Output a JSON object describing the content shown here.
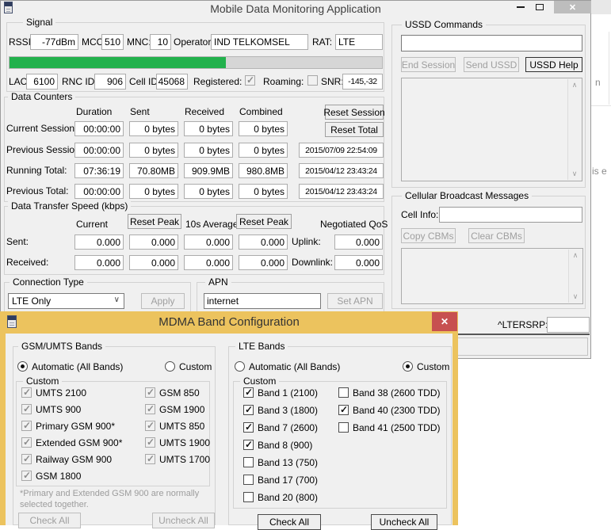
{
  "window": {
    "title": "Mobile Data Monitoring Application"
  },
  "icons": {
    "close_x": "✕",
    "scroll_up": "∧",
    "scroll_down": "∨",
    "combo_chevron": "∨"
  },
  "signal": {
    "legend": "Signal",
    "rssi_label": "RSSI:",
    "rssi": "-77dBm",
    "mcc_label": "MCC:",
    "mcc": "510",
    "mnc_label": "MNC:",
    "mnc": "10",
    "operator_label": "Operator:",
    "operator": "IND TELKOMSEL",
    "rat_label": "RAT:",
    "rat": "LTE",
    "strength_percent": 58,
    "lac_label": "LAC:",
    "lac": "6100",
    "rnc_label": "RNC ID:",
    "rnc": "906",
    "cellid_label": "Cell ID:",
    "cellid": "45068",
    "registered_label": "Registered:",
    "registered_checked": true,
    "roaming_label": "Roaming:",
    "roaming_checked": false,
    "snr_label": "SNR:",
    "snr": "-145,-32"
  },
  "counters": {
    "legend": "Data Counters",
    "headers": {
      "duration": "Duration",
      "sent": "Sent",
      "received": "Received",
      "combined": "Combined"
    },
    "reset_session_btn": "Reset Session",
    "reset_total_btn": "Reset Total",
    "rows": [
      {
        "label": "Current Session:",
        "duration": "00:00:00",
        "sent": "0 bytes",
        "received": "0 bytes",
        "combined": "0 bytes",
        "timestamp": ""
      },
      {
        "label": "Previous Session:",
        "duration": "00:00:00",
        "sent": "0 bytes",
        "received": "0 bytes",
        "combined": "0 bytes",
        "timestamp": "2015/07/09 22:54:09"
      },
      {
        "label": "Running Total:",
        "duration": "07:36:19",
        "sent": "70.80MB",
        "received": "909.9MB",
        "combined": "980.8MB",
        "timestamp": "2015/04/12 23:43:24"
      },
      {
        "label": "Previous Total:",
        "duration": "00:00:00",
        "sent": "0 bytes",
        "received": "0 bytes",
        "combined": "0 bytes",
        "timestamp": "2015/04/12 23:43:24"
      }
    ]
  },
  "speed": {
    "legend": "Data Transfer Speed (kbps)",
    "current_header": "Current",
    "reset_peak_btn": "Reset Peak",
    "avg_header": "10s Average",
    "qos_header": "Negotiated QoS",
    "rows": [
      {
        "label": "Sent:",
        "values": [
          "0.000",
          "0.000",
          "0.000",
          "0.000"
        ],
        "qos_label": "Uplink:",
        "qos": "0.000"
      },
      {
        "label": "Received:",
        "values": [
          "0.000",
          "0.000",
          "0.000",
          "0.000"
        ],
        "qos_label": "Downlink:",
        "qos": "0.000"
      }
    ]
  },
  "connection": {
    "legend": "Connection Type",
    "selected": "LTE Only",
    "apply_btn": "Apply"
  },
  "apn": {
    "legend": "APN",
    "value": "internet",
    "set_btn": "Set APN"
  },
  "ussd": {
    "legend": "USSD Commands",
    "input": "",
    "end_btn": "End Session",
    "send_btn": "Send USSD",
    "help_btn": "USSD Help"
  },
  "cbm": {
    "legend": "Cellular Broadcast Messages",
    "cell_info_label": "Cell Info:",
    "cell_info": "",
    "copy_btn": "Copy CBMs",
    "clear_btn": "Clear CBMs"
  },
  "ltersrp": {
    "label": "^LTERSRP:",
    "value": ""
  },
  "dialog": {
    "title": "MDMA Band Configuration",
    "gsm": {
      "legend": "GSM/UMTS Bands",
      "auto_label": "Automatic (All Bands)",
      "auto_selected": true,
      "custom_label": "Custom",
      "custom_selected": false,
      "custom_legend": "Custom",
      "col1": [
        {
          "label": "UMTS 2100",
          "checked": true
        },
        {
          "label": "UMTS 900",
          "checked": true
        },
        {
          "label": "Primary GSM 900*",
          "checked": true
        },
        {
          "label": "Extended GSM 900*",
          "checked": true
        },
        {
          "label": "Railway GSM 900",
          "checked": true
        },
        {
          "label": "GSM 1800",
          "checked": true
        }
      ],
      "col2": [
        {
          "label": "GSM 850",
          "checked": true
        },
        {
          "label": "GSM 1900",
          "checked": true
        },
        {
          "label": "UMTS 850",
          "checked": true
        },
        {
          "label": "UMTS 1900",
          "checked": true
        },
        {
          "label": "UMTS 1700",
          "checked": true
        }
      ],
      "note_line1": "*Primary and Extended GSM 900 are normally",
      "note_line2": "selected together.",
      "check_all_btn": "Check All",
      "uncheck_all_btn": "Uncheck All"
    },
    "lte": {
      "legend": "LTE Bands",
      "auto_label": "Automatic (All Bands)",
      "auto_selected": false,
      "custom_label": "Custom",
      "custom_selected": true,
      "custom_legend": "Custom",
      "col1": [
        {
          "label": "Band 1 (2100)",
          "checked": true
        },
        {
          "label": "Band 3 (1800)",
          "checked": true
        },
        {
          "label": "Band 7 (2600)",
          "checked": true
        },
        {
          "label": "Band 8 (900)",
          "checked": true
        },
        {
          "label": "Band 13 (750)",
          "checked": false
        },
        {
          "label": "Band 17 (700)",
          "checked": false
        },
        {
          "label": "Band 20 (800)",
          "checked": false
        }
      ],
      "col2": [
        {
          "label": "Band 38 (2600 TDD)",
          "checked": false
        },
        {
          "label": "Band 40 (2300 TDD)",
          "checked": true
        },
        {
          "label": "Band 41 (2500 TDD)",
          "checked": false
        }
      ],
      "check_all_btn": "Check All",
      "uncheck_all_btn": "Uncheck All"
    }
  },
  "background": {
    "fragment_top": "n",
    "fragment_bottom": "is e"
  },
  "colors": {
    "progress_green": "#22B14C",
    "dialog_gold": "#ECC35E",
    "dialog_close_red": "#C75050"
  }
}
